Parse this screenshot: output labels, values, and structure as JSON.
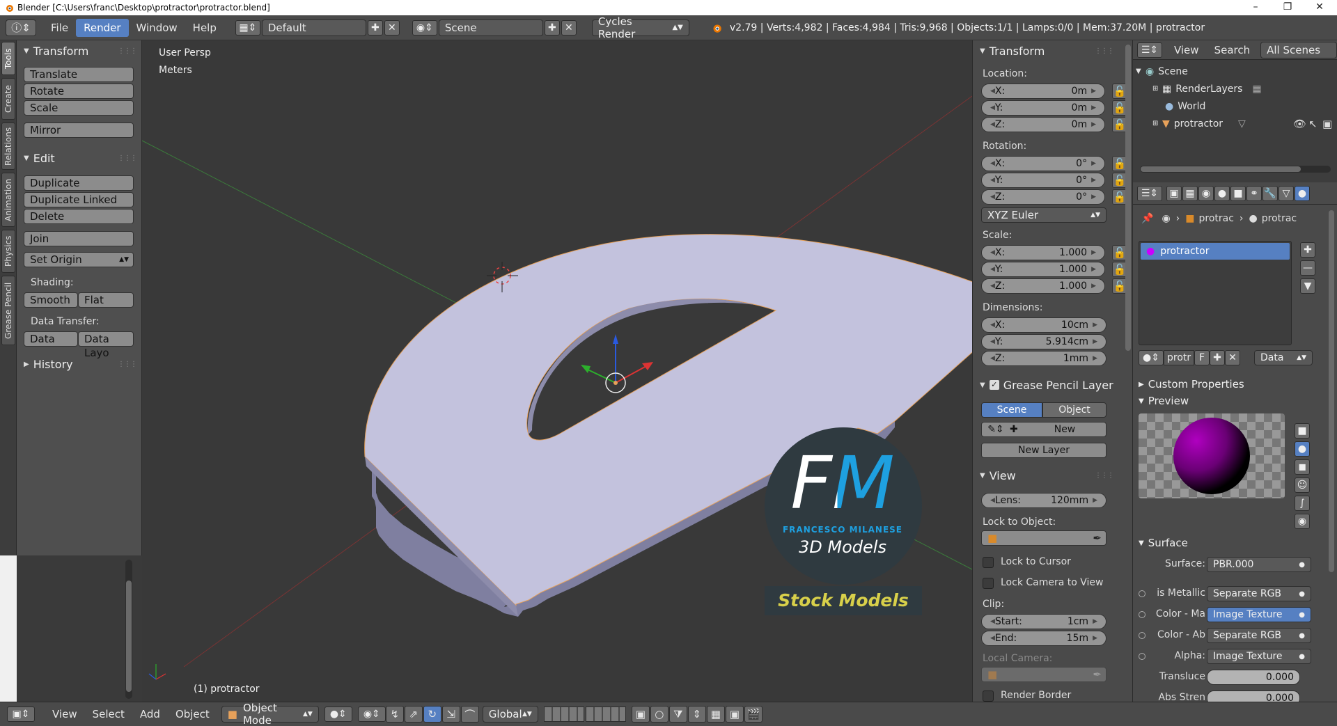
{
  "window": {
    "title": "Blender  [C:\\Users\\franc\\Desktop\\protractor\\protractor.blend]"
  },
  "info_header": {
    "menus": [
      "File",
      "Render",
      "Window",
      "Help"
    ],
    "active_menu": "Render",
    "layout": "Default",
    "scene": "Scene",
    "render_engine": "Cycles Render",
    "stats": "v2.79 | Verts:4,982 | Faces:4,984 | Tris:9,968 | Objects:1/1 | Lamps:0/0 | Mem:37.20M | protractor"
  },
  "left_tabs": [
    "Tools",
    "Create",
    "Relations",
    "Animation",
    "Physics",
    "Grease Pencil"
  ],
  "tool_shelf": {
    "transform": {
      "title": "Transform",
      "buttons": [
        "Translate",
        "Rotate",
        "Scale",
        "Mirror"
      ]
    },
    "edit": {
      "title": "Edit",
      "buttons": [
        "Duplicate",
        "Duplicate Linked",
        "Delete",
        "Join"
      ],
      "set_origin": "Set Origin",
      "shading_label": "Shading:",
      "smooth": "Smooth",
      "flat": "Flat",
      "data_transfer_label": "Data Transfer:",
      "data": "Data",
      "data_layout": "Data Layo"
    },
    "history": {
      "title": "History"
    }
  },
  "viewport": {
    "view_name": "User Persp",
    "units": "Meters",
    "object_label": "(1) protractor",
    "watermark": {
      "letters": "FM",
      "name": "FRANCESCO MILANESE",
      "sub": "3D Models",
      "stock": "Stock Models"
    }
  },
  "view_header": {
    "menus": [
      "View",
      "Select",
      "Add",
      "Object"
    ],
    "mode": "Object Mode",
    "orientation": "Global"
  },
  "n_panel": {
    "transform_title": "Transform",
    "location_label": "Location:",
    "location": [
      {
        "axis": "X:",
        "value": "0m"
      },
      {
        "axis": "Y:",
        "value": "0m"
      },
      {
        "axis": "Z:",
        "value": "0m"
      }
    ],
    "rotation_label": "Rotation:",
    "rotation": [
      {
        "axis": "X:",
        "value": "0°"
      },
      {
        "axis": "Y:",
        "value": "0°"
      },
      {
        "axis": "Z:",
        "value": "0°"
      }
    ],
    "rotation_mode": "XYZ Euler",
    "scale_label": "Scale:",
    "scale": [
      {
        "axis": "X:",
        "value": "1.000"
      },
      {
        "axis": "Y:",
        "value": "1.000"
      },
      {
        "axis": "Z:",
        "value": "1.000"
      }
    ],
    "dimensions_label": "Dimensions:",
    "dimensions": [
      {
        "axis": "X:",
        "value": "10cm"
      },
      {
        "axis": "Y:",
        "value": "5.914cm"
      },
      {
        "axis": "Z:",
        "value": "1mm"
      }
    ],
    "grease_pencil_title": "Grease Pencil Layer",
    "gp_scene": "Scene",
    "gp_object": "Object",
    "gp_new": "New",
    "gp_new_layer": "New Layer",
    "view_title": "View",
    "lens_label": "Lens:",
    "lens_value": "120mm",
    "lock_to_object": "Lock to Object:",
    "lock_to_cursor": "Lock to Cursor",
    "lock_camera": "Lock Camera to View",
    "clip_label": "Clip:",
    "clip_start_label": "Start:",
    "clip_start": "1cm",
    "clip_end_label": "End:",
    "clip_end": "15m",
    "local_camera": "Local Camera:",
    "render_border": "Render Border"
  },
  "outliner": {
    "menus": [
      "View",
      "Search"
    ],
    "filter": "All Scenes",
    "items": [
      "Scene",
      "RenderLayers",
      "World",
      "protractor"
    ]
  },
  "properties": {
    "breadcrumb": [
      "protrac",
      "protrac"
    ],
    "material_slot": "protractor",
    "material_short": "protr",
    "fake_user": "F",
    "link": "Data",
    "custom_properties": "Custom Properties",
    "preview": "Preview",
    "surface_title": "Surface",
    "surface_label": "Surface:",
    "surface_value": "PBR.000",
    "inputs": [
      {
        "label": "is Metallic",
        "value": "Separate RGB",
        "style": "normal"
      },
      {
        "label": "Color - Ma",
        "value": "Image Texture",
        "style": "blue"
      },
      {
        "label": "Color - Ab",
        "value": "Separate RGB",
        "style": "normal"
      },
      {
        "label": "Alpha:",
        "value": "Image Texture",
        "style": "normal"
      },
      {
        "label": "Transluce",
        "value": "0.000",
        "style": "slider"
      },
      {
        "label": "Abs Stren",
        "value": "0.000",
        "style": "slider"
      }
    ]
  },
  "colors": {
    "accent": "#5680c2",
    "viewport_bg": "#393939",
    "model": "#c3c2dd",
    "outline": "#e7a15a",
    "fm_blue": "#1ea0e0",
    "stock_yellow": "#d8d04a"
  }
}
